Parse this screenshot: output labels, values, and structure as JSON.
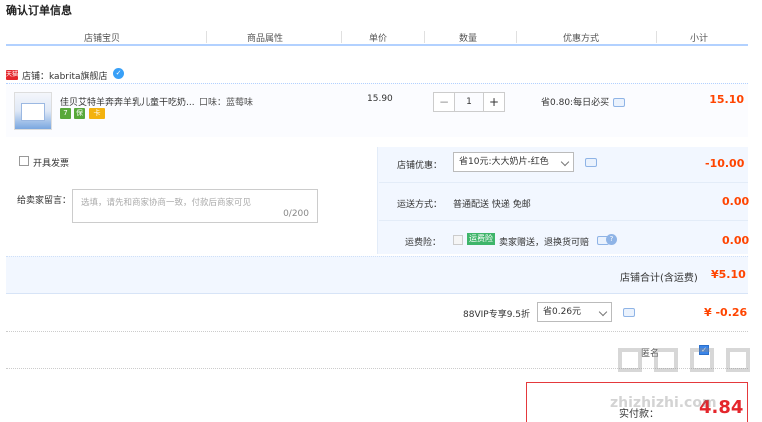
{
  "page_title": "确认订单信息",
  "columns": [
    "店铺宝贝",
    "商品属性",
    "单价",
    "数量",
    "优惠方式",
    "小计"
  ],
  "shop": {
    "badge": "天猫",
    "label": "店铺：kabrita旗舰店"
  },
  "item": {
    "name": "佳贝艾特羊奔奔羊乳儿童干吃奶...",
    "sku": "口味：蓝莓味",
    "service_icons": [
      "7",
      "保",
      "卡"
    ],
    "price": "15.90",
    "quantity": "1",
    "qty_minus": "−",
    "qty_plus": "+",
    "promo": "省0.80:每日必买",
    "subtotal": "15.10"
  },
  "options": {
    "invoice_label": "开具发票",
    "message_label": "给卖家留言：",
    "message_placeholder": "选填，请先和商家协商一致，付款后商家可见",
    "message_count": "0/200",
    "shop_discount_label": "店铺优惠：",
    "shop_discount_value": "省10元:大大奶片-红色",
    "shop_discount_amount": "-10.00",
    "shipping_label": "运送方式：",
    "shipping_value": "普通配送 快递 免邮",
    "shipping_amount": "0.00",
    "insurance_label": "运费险：",
    "insurance_tag": "运费险",
    "insurance_text": "卖家赠送，退换货可赔",
    "insurance_amount": "0.00"
  },
  "shop_total": {
    "label": "店铺合计(含运费)",
    "amount": "¥5.10"
  },
  "vip": {
    "label": "88VIP专享9.5折",
    "select": "省0.26元",
    "amount": "¥ -0.26"
  },
  "bottom": {
    "anon_label": "匿名",
    "final_label": "实付款：",
    "final_amount": "4.84"
  },
  "watermark": "zhizhizhi.com",
  "colors": {
    "accent_red": "#ff4400",
    "header_line": "#b2d1ff",
    "panel_bg": "#f2f7ff"
  }
}
